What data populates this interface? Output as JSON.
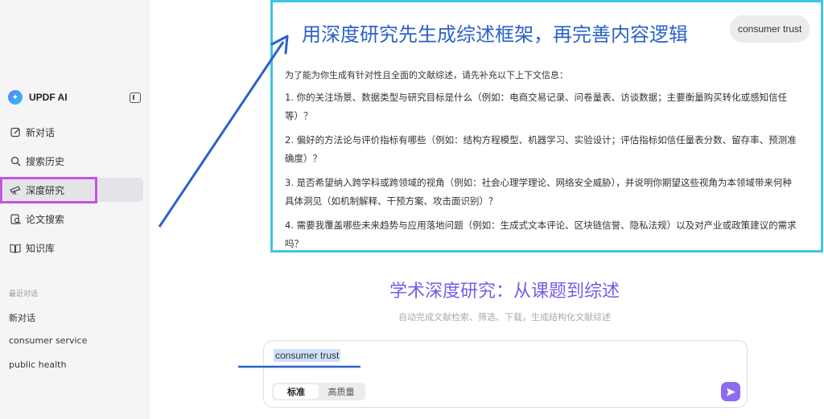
{
  "sidebar": {
    "brand": "UPDF AI",
    "nav": [
      {
        "label": "新对话",
        "icon": "edit-icon"
      },
      {
        "label": "搜索历史",
        "icon": "search-icon"
      },
      {
        "label": "深度研究",
        "icon": "telescope-icon"
      },
      {
        "label": "论文搜索",
        "icon": "paper-search-icon"
      },
      {
        "label": "知识库",
        "icon": "book-icon"
      }
    ],
    "recent_label": "最近对话",
    "recent": [
      "新对话",
      "consumer service",
      "public health"
    ]
  },
  "overlay": {
    "title": "用深度研究先生成综述框架，再完善内容逻辑",
    "chip": "consumer trust",
    "intro": "为了能为你生成有针对性且全面的文献综述，请先补充以下上下文信息：",
    "items": [
      "1. 你的关注场景、数据类型与研究目标是什么（例如：电商交易记录、问卷量表、访谈数据；主要衡量购买转化或感知信任等）？",
      "2. 偏好的方法论与评价指标有哪些（例如：结构方程模型、机器学习、实验设计；评估指标如信任量表分数、留存率、预测准确度）？",
      "3. 是否希望纳入跨学科或跨领域的视角（例如：社会心理学理论、网络安全威胁），并说明你期望这些视角为本领域带来何种具体洞见（如机制解释、干预方案、攻击面识别）？",
      "4. 需要我覆盖哪些未来趋势与应用落地问题（例如：生成式文本评论、区块链信誉、隐私法规）以及对产业或政策建议的需求吗？"
    ]
  },
  "main": {
    "hero_title": "学术深度研究：从课题到综述",
    "hero_subtitle": "自动完成文献检索、筛选、下载，生成结构化文献综述",
    "input_value": "consumer trust",
    "modes": [
      "标准",
      "高质量"
    ],
    "selected_mode": "标准"
  },
  "colors": {
    "highlight_box": "#c653e0",
    "overlay_border": "#3fc4e4",
    "arrow": "#2d62c8",
    "hero": "#7b5be8",
    "send": "#8b6cf2"
  }
}
